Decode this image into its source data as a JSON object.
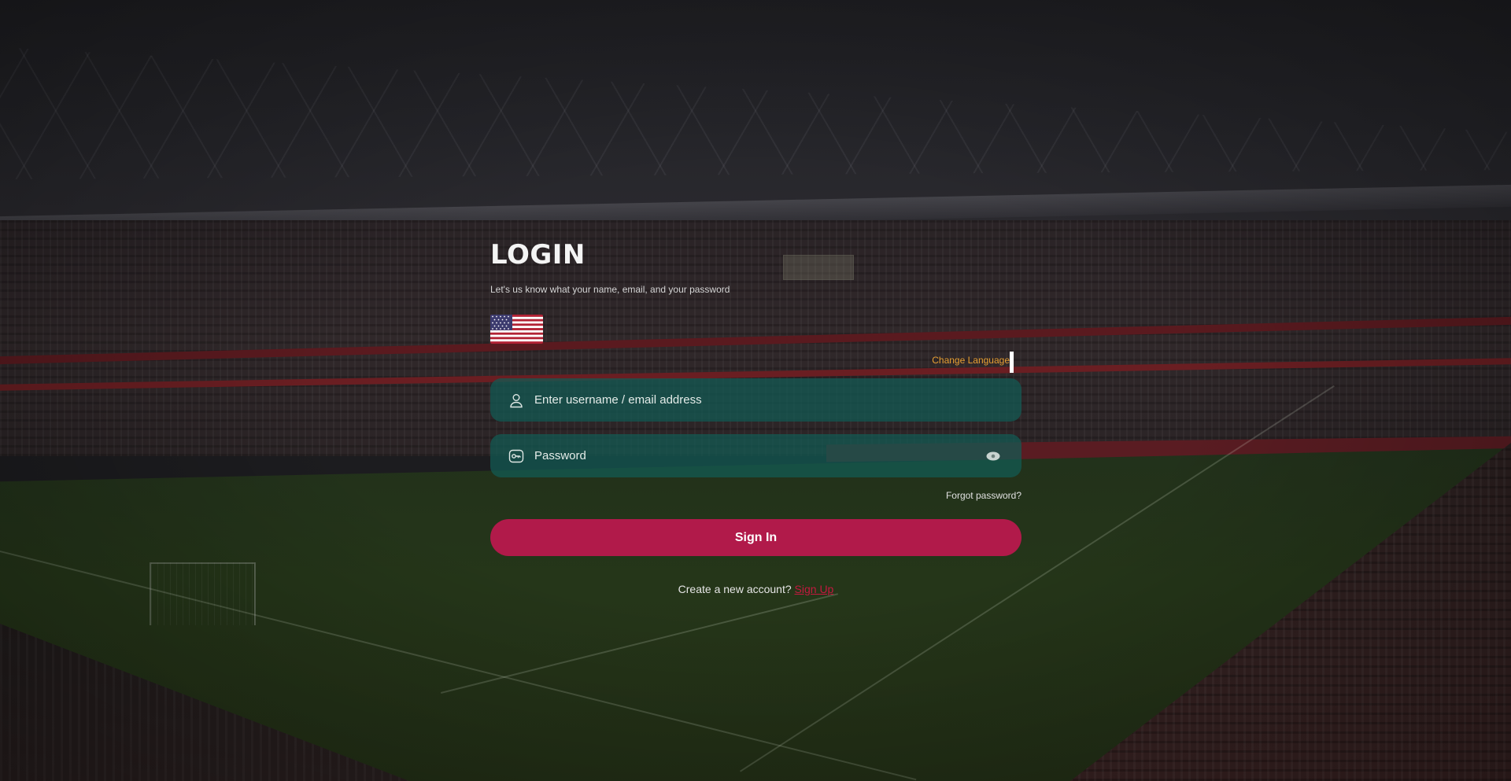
{
  "login": {
    "title": "LOGIN",
    "subtitle": "Let's us know what your name, email, and your password",
    "flag_icon": "us-flag-icon",
    "change_language": "Change Language",
    "username_placeholder": "Enter username / email address",
    "password_placeholder": "Password",
    "forgot_password": "Forgot password?",
    "sign_in_label": "Sign In",
    "signup_prompt": "Create a new account?",
    "signup_link": "Sign Up"
  },
  "colors": {
    "accent_button": "#b11a4a",
    "input_bg": "#125c54",
    "change_language": "#e8a033",
    "signup_link": "#c2193f"
  },
  "icons": {
    "username": "user-icon",
    "password": "key-icon",
    "toggle_visibility": "eye-icon"
  }
}
